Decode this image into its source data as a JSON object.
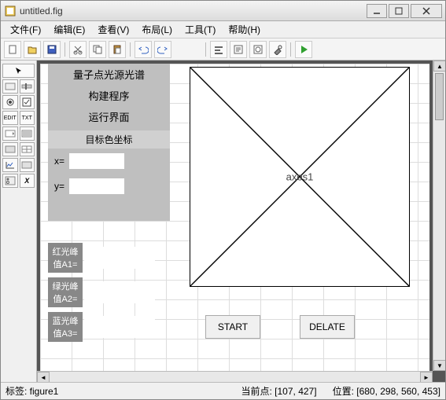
{
  "window": {
    "title": "untitled.fig"
  },
  "menu": {
    "file": "文件(F)",
    "edit": "编辑(E)",
    "view": "查看(V)",
    "layout": "布局(L)",
    "tools": "工具(T)",
    "help": "帮助(H)"
  },
  "panel": {
    "title1": "量子点光源光谱",
    "title2": "构建程序",
    "title3": "运行界面",
    "target_label": "目标色坐标",
    "x_label": "x=",
    "y_label": "y=",
    "x_value": "",
    "y_value": ""
  },
  "peaks": {
    "red_label": "红光峰值A1=",
    "green_label": "绿光峰值A2=",
    "blue_label": "蓝光峰值A3=",
    "a1": "",
    "a2": "",
    "a3": ""
  },
  "axes": {
    "label": "axes1"
  },
  "buttons": {
    "start": "START",
    "delate": "DELATE"
  },
  "status": {
    "tag": "标签: figure1",
    "current_point": "当前点: [107, 427]",
    "position": "位置: [680, 298, 560, 453]"
  }
}
